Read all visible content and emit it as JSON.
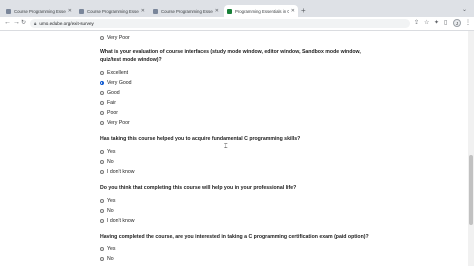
{
  "browser": {
    "tabs": [
      {
        "label": "Course Programming Essentials"
      },
      {
        "label": "Course Programming Essentials"
      },
      {
        "label": "Course Programming Essentials"
      },
      {
        "label": "Programming Essentials in C"
      }
    ],
    "new_tab": "+",
    "url": "umo.edube.org/exit-survey",
    "profile_initial": "J"
  },
  "survey": {
    "top_option": "Very Poor",
    "questions": [
      {
        "text": "What is your evaluation of course interfaces (study mode window, editor window, Sandbox mode window, quiz/test mode window)?",
        "options": [
          "Excellent",
          "Very Good",
          "Good",
          "Fair",
          "Poor",
          "Very Poor"
        ],
        "selected": "Very Good"
      },
      {
        "text": "Has taking this course helped you to acquire fundamental C programming skills?",
        "options": [
          "Yes",
          "No",
          "I don't know"
        ]
      },
      {
        "text": "Do you think that completing this course will help you in your professional life?",
        "options": [
          "Yes",
          "No",
          "I don't know"
        ]
      },
      {
        "text": "Having completed the course, are you interested in taking a C programming certification exam (paid option)?",
        "options": [
          "Yes",
          "No"
        ]
      }
    ]
  }
}
